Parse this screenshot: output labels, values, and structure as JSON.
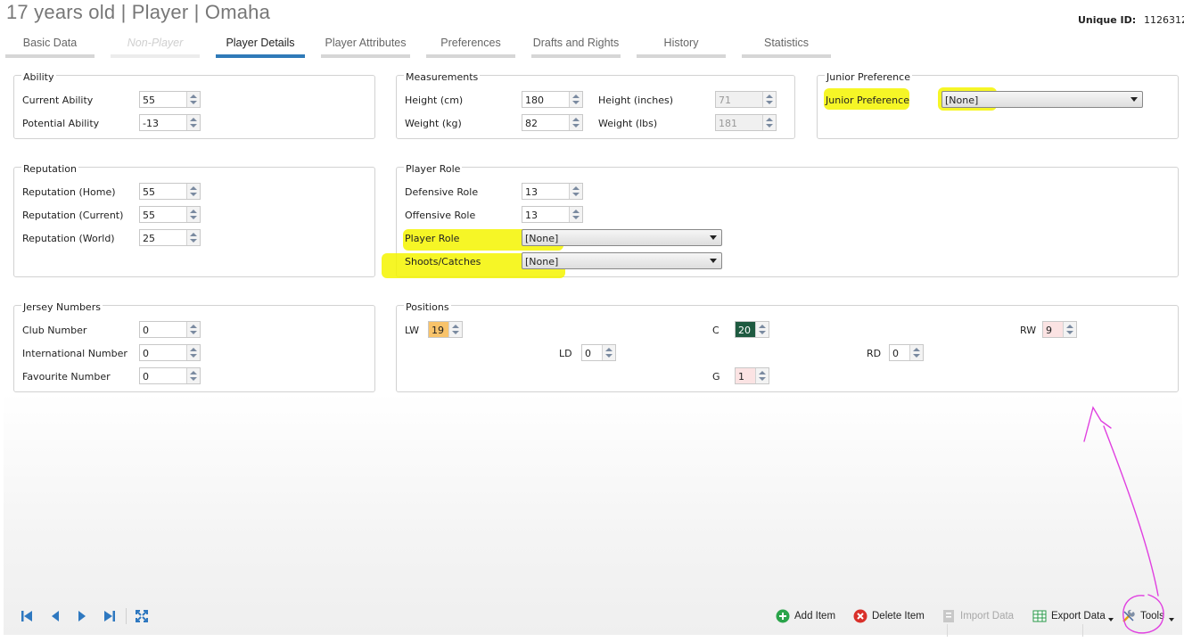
{
  "header": {
    "title": "17 years old | Player | Omaha",
    "unique_id_label": "Unique ID:",
    "unique_id_value": "1126312"
  },
  "tabs": [
    {
      "label": "Basic Data",
      "state": "normal"
    },
    {
      "label": "Non-Player",
      "state": "disabled"
    },
    {
      "label": "Player Details",
      "state": "active"
    },
    {
      "label": "Player Attributes",
      "state": "normal"
    },
    {
      "label": "Preferences",
      "state": "normal"
    },
    {
      "label": "Drafts and Rights",
      "state": "normal"
    },
    {
      "label": "History",
      "state": "normal"
    },
    {
      "label": "Statistics",
      "state": "normal"
    }
  ],
  "ability": {
    "title": "Ability",
    "current_label": "Current Ability",
    "current_value": "55",
    "potential_label": "Potential Ability",
    "potential_value": "-13"
  },
  "measurements": {
    "title": "Measurements",
    "height_cm_label": "Height (cm)",
    "height_cm_value": "180",
    "weight_kg_label": "Weight (kg)",
    "weight_kg_value": "82",
    "height_in_label": "Height (inches)",
    "height_in_value": "71",
    "weight_lbs_label": "Weight (lbs)",
    "weight_lbs_value": "181"
  },
  "junior": {
    "title": "Junior Preference",
    "label": "Junior Preference",
    "value": "[None]"
  },
  "reputation": {
    "title": "Reputation",
    "home_label": "Reputation (Home)",
    "home_value": "55",
    "current_label": "Reputation (Current)",
    "current_value": "55",
    "world_label": "Reputation (World)",
    "world_value": "25"
  },
  "player_role": {
    "title": "Player Role",
    "defensive_label": "Defensive Role",
    "defensive_value": "13",
    "offensive_label": "Offensive Role",
    "offensive_value": "13",
    "role_label": "Player Role",
    "role_value": "[None]",
    "shoots_label": "Shoots/Catches",
    "shoots_value": "[None]"
  },
  "jersey": {
    "title": "Jersey Numbers",
    "club_label": "Club Number",
    "club_value": "0",
    "intl_label": "International Number",
    "intl_value": "0",
    "fav_label": "Favourite Number",
    "fav_value": "0"
  },
  "positions": {
    "title": "Positions",
    "lw_label": "LW",
    "lw_value": "19",
    "c_label": "C",
    "c_value": "20",
    "rw_label": "RW",
    "rw_value": "9",
    "ld_label": "LD",
    "ld_value": "0",
    "rd_label": "RD",
    "rd_value": "0",
    "g_label": "G",
    "g_value": "1",
    "colors": {
      "lw": "#f8c36a",
      "c": "#1e5a40",
      "rw": "#fbe3e3",
      "g": "#fbe3e3",
      "ld": "#ffffff",
      "rd": "#ffffff"
    }
  },
  "toolbar": {
    "add_item": "Add Item",
    "delete_item": "Delete Item",
    "import_data": "Import Data",
    "export_data": "Export Data",
    "tools": "Tools"
  },
  "colors": {
    "accent": "#2f7ab8",
    "highlight": "#f4f400",
    "annotation": "#e040e0"
  }
}
